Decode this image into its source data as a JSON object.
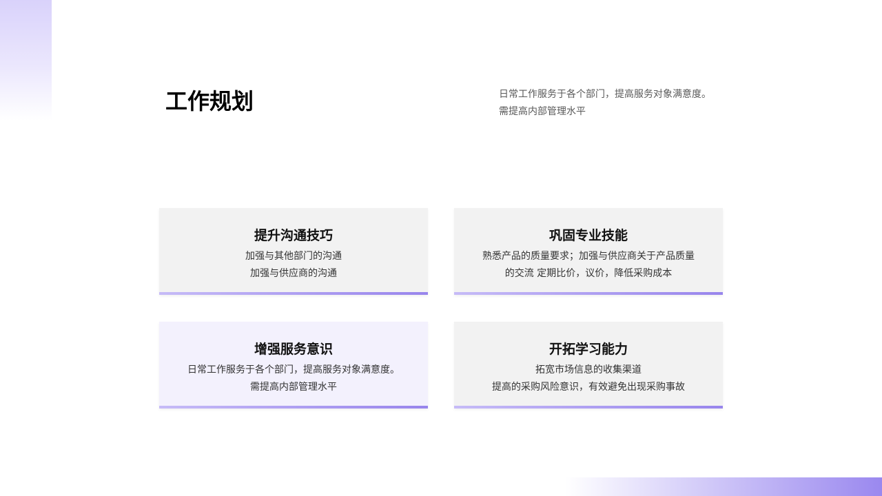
{
  "header": {
    "title": "工作规划",
    "intro_lines": [
      "日常工作服务于各个部门，提高服务对象满意度。",
      "需提高内部管理水平"
    ]
  },
  "cards": [
    {
      "title": "提升沟通技巧",
      "lines": [
        "加强与其他部门的沟通",
        "加强与供应商的沟通"
      ],
      "background": "#f2f2f2"
    },
    {
      "title": "巩固专业技能",
      "lines": [
        "熟悉产品的质量要求；加强与供应商关于产品质量",
        "的交流  定期比价，议价，降低采购成本"
      ],
      "background": "#f2f2f2"
    },
    {
      "title": "增强服务意识",
      "lines": [
        "日常工作服务于各个部门，提高服务对象满意度。",
        "需提高内部管理水平"
      ],
      "background": "#f3f1fd"
    },
    {
      "title": "开拓学习能力",
      "lines": [
        "拓宽市场信息的收集渠道",
        "提高的采购风险意识，有效避免出现采购事故"
      ],
      "background": "#f2f2f2"
    }
  ],
  "colors": {
    "accent": "#9885ec",
    "accent_light": "#c6bbf7"
  }
}
